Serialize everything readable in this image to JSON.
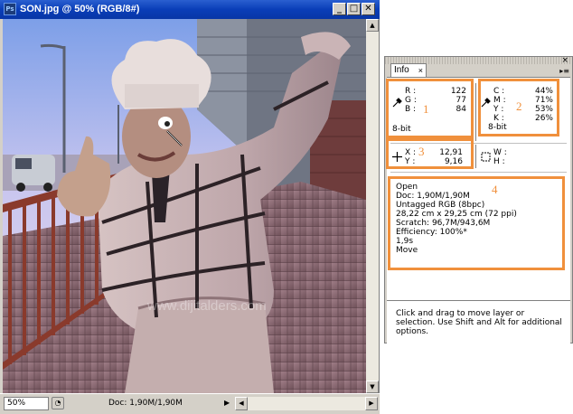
{
  "document": {
    "title": "SON.jpg @ 50% (RGB/8#)",
    "app_icon": "Ps",
    "window_buttons": [
      "_",
      "□",
      "✕"
    ],
    "zoom": "50%",
    "status_doc": "Doc: 1,90M/1,90M",
    "watermark": "www.dijitalders.com"
  },
  "info_panel": {
    "tab_label": "Info",
    "tab_close": "×",
    "rgb": {
      "labels": [
        "R :",
        "G :",
        "B :"
      ],
      "values": [
        "122",
        "77",
        "84"
      ],
      "bitdepth": "8-bit"
    },
    "cmyk": {
      "labels": [
        "C :",
        "M :",
        "Y :",
        "K :"
      ],
      "values": [
        "44%",
        "71%",
        "53%",
        "26%"
      ],
      "bitdepth": "8-bit"
    },
    "xy": {
      "labels": [
        "X :",
        "Y :"
      ],
      "values": [
        "12,91",
        "9,16"
      ]
    },
    "wh": {
      "labels": [
        "W :",
        "H :"
      ]
    },
    "status_lines": [
      "Open",
      "Doc: 1,90M/1,90M",
      "Untagged RGB (8bpc)",
      "28,22 cm x 29,25 cm (72 ppi)",
      "Scratch: 96,7M/943,6M",
      "Efficiency: 100%*",
      "1,9s",
      "Move"
    ],
    "help_text": "Click and drag to move layer or selection.  Use Shift and Alt for additional options."
  },
  "annotations": [
    "1",
    "2",
    "3",
    "4"
  ],
  "colors": {
    "annotation": "#f0903c",
    "titlebar": "#0a3eb8"
  }
}
